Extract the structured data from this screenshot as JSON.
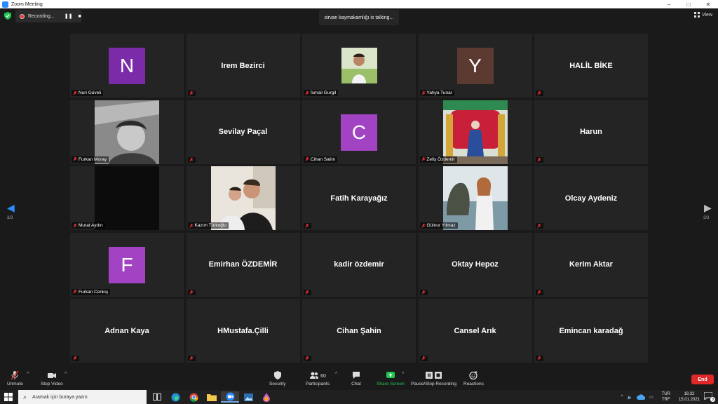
{
  "window": {
    "title": "Zoom Meeting",
    "controls": [
      "–",
      "□",
      "✕"
    ]
  },
  "topbar": {
    "recording_label": "Recording...",
    "pause_glyph": "❚❚",
    "stop_glyph": "■",
    "talking": "sirvan kaymakamlığı is talking...",
    "view_label": "View"
  },
  "nav": {
    "left_page": "3/3",
    "right_page": "3/3"
  },
  "tiles": [
    {
      "name": "Nuri Güveli",
      "kind": "avatar",
      "letter": "N",
      "color": "#7b2aa8",
      "label": "Nuri Güveli"
    },
    {
      "name": "Irem Bezirci",
      "kind": "text",
      "label": ""
    },
    {
      "name": "İsmail Gurgil",
      "kind": "photo-small",
      "label": "İsmail Gurgil"
    },
    {
      "name": "Yahya Tunar",
      "kind": "avatar",
      "letter": "Y",
      "color": "#5b3a31",
      "label": "Yahya Tunar"
    },
    {
      "name": "HALİL BİKE",
      "kind": "text",
      "label": ""
    },
    {
      "name": "Furkan Moray",
      "kind": "video-bw",
      "label": "Furkan Moray"
    },
    {
      "name": "Sevilay Paçal",
      "kind": "text",
      "label": ""
    },
    {
      "name": "Cihan Salim",
      "kind": "avatar",
      "letter": "C",
      "color": "#a243c4",
      "label": "Cihan Salim"
    },
    {
      "name": "Zeliş Özdemir",
      "kind": "video-red",
      "label": "Zeliş Özdemir"
    },
    {
      "name": "Harun",
      "kind": "text",
      "label": ""
    },
    {
      "name": "Murat Aydın",
      "kind": "video-dark",
      "label": "Murat Aydın"
    },
    {
      "name": "Kazım Türkoğlu",
      "kind": "video-selfie",
      "label": "Kazım Türkoğlu"
    },
    {
      "name": "Fatih Karayağız",
      "kind": "text",
      "label": ""
    },
    {
      "name": "Gülnur Yılmaz",
      "kind": "video-sea",
      "label": "Gülnur Yılmaz"
    },
    {
      "name": "Olcay Aydeniz",
      "kind": "text",
      "label": ""
    },
    {
      "name": "Furkan Cenkış",
      "kind": "avatar",
      "letter": "F",
      "color": "#a243c4",
      "label": "Furkan Cenkış"
    },
    {
      "name": "Emirhan ÖZDEMİR",
      "kind": "text",
      "label": ""
    },
    {
      "name": "kadir özdemir",
      "kind": "text",
      "label": ""
    },
    {
      "name": "Oktay Hepoz",
      "kind": "text",
      "label": ""
    },
    {
      "name": "Kerim Aktar",
      "kind": "text",
      "label": ""
    },
    {
      "name": "Adnan Kaya",
      "kind": "text",
      "label": ""
    },
    {
      "name": "HMustafa.Çilli",
      "kind": "text",
      "label": ""
    },
    {
      "name": "Cihan Şahin",
      "kind": "text",
      "label": ""
    },
    {
      "name": "Cansel Arık",
      "kind": "text",
      "label": ""
    },
    {
      "name": "Emincan karadağ",
      "kind": "text",
      "label": ""
    }
  ],
  "controls": {
    "unmute": "Unmute",
    "stop_video": "Stop Video",
    "security": "Security",
    "participants": "Participants",
    "participants_count": "60",
    "chat": "Chat",
    "share_screen": "Share Screen",
    "pause_stop_recording": "Pause/Stop Recording",
    "reactions": "Reactions",
    "end": "End"
  },
  "taskbar": {
    "search_placeholder": "Aramak için buraya yazın",
    "lang_1": "TUR",
    "lang_2": "TRF",
    "time": "16:32",
    "date": "15.01.2021",
    "notif_count": "3"
  },
  "icons": [
    "shield-icon",
    "mic-muted-icon",
    "video-icon",
    "security-icon",
    "participants-icon",
    "chat-icon",
    "share-screen-icon",
    "recording-icon",
    "reactions-icon",
    "windows-icon",
    "search-icon",
    "task-view-icon",
    "edge-icon",
    "chrome-icon",
    "folder-icon",
    "zoom-icon",
    "photos-icon",
    "paint-icon"
  ],
  "colors": {
    "accent_blue": "#2d8cff",
    "end_red": "#e02828",
    "share_green": "#23c552",
    "mute_red": "#e53030"
  }
}
